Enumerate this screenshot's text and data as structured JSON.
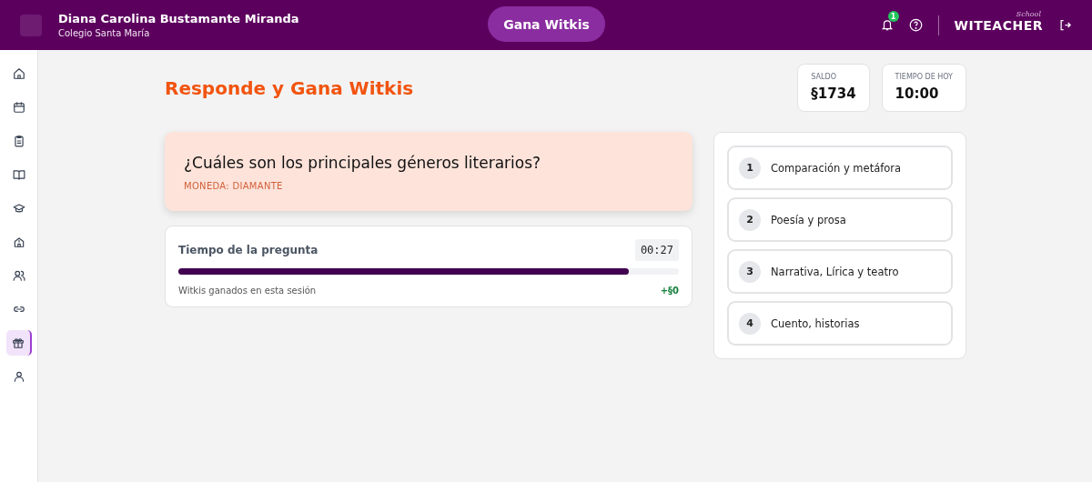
{
  "header": {
    "user_name": "Diana Carolina Bustamante Miranda",
    "school": "Colegio Santa María",
    "center_button": "Gana Witkis",
    "notification_count": "1",
    "logo": "WITEACHER",
    "logo_script": "School"
  },
  "sidebar": {
    "items": [
      {
        "kind": "home",
        "selected": false
      },
      {
        "kind": "calendar",
        "selected": false
      },
      {
        "kind": "clipboard",
        "selected": false
      },
      {
        "kind": "book",
        "selected": false
      },
      {
        "kind": "cap",
        "selected": false
      },
      {
        "kind": "school",
        "selected": false
      },
      {
        "kind": "users",
        "selected": false
      },
      {
        "kind": "link",
        "selected": false
      },
      {
        "kind": "gift",
        "selected": true
      },
      {
        "kind": "user",
        "selected": false
      }
    ]
  },
  "page_title": "Responde y Gana Witkis",
  "stats": [
    {
      "label": "SALDO",
      "value": "§1734"
    },
    {
      "label": "TIEMPO DE HOY",
      "value": "10:00"
    }
  ],
  "question": {
    "text": "¿Cuáles son los principales géneros literarios?",
    "coin": "MONEDA: DIAMANTE"
  },
  "timer": {
    "label": "Tiempo de la pregunta",
    "time": "00:27",
    "level": 0.9,
    "session_label": "Witkis ganados en esta sesión",
    "session_value": "+§0"
  },
  "options": [
    {
      "number": "1",
      "text": "Comparación y metáfora"
    },
    {
      "number": "2",
      "text": "Poesía y prosa"
    },
    {
      "number": "3",
      "text": "Narrativa, Lírica y teatro"
    },
    {
      "number": "4",
      "text": "Cuento, historias"
    }
  ]
}
